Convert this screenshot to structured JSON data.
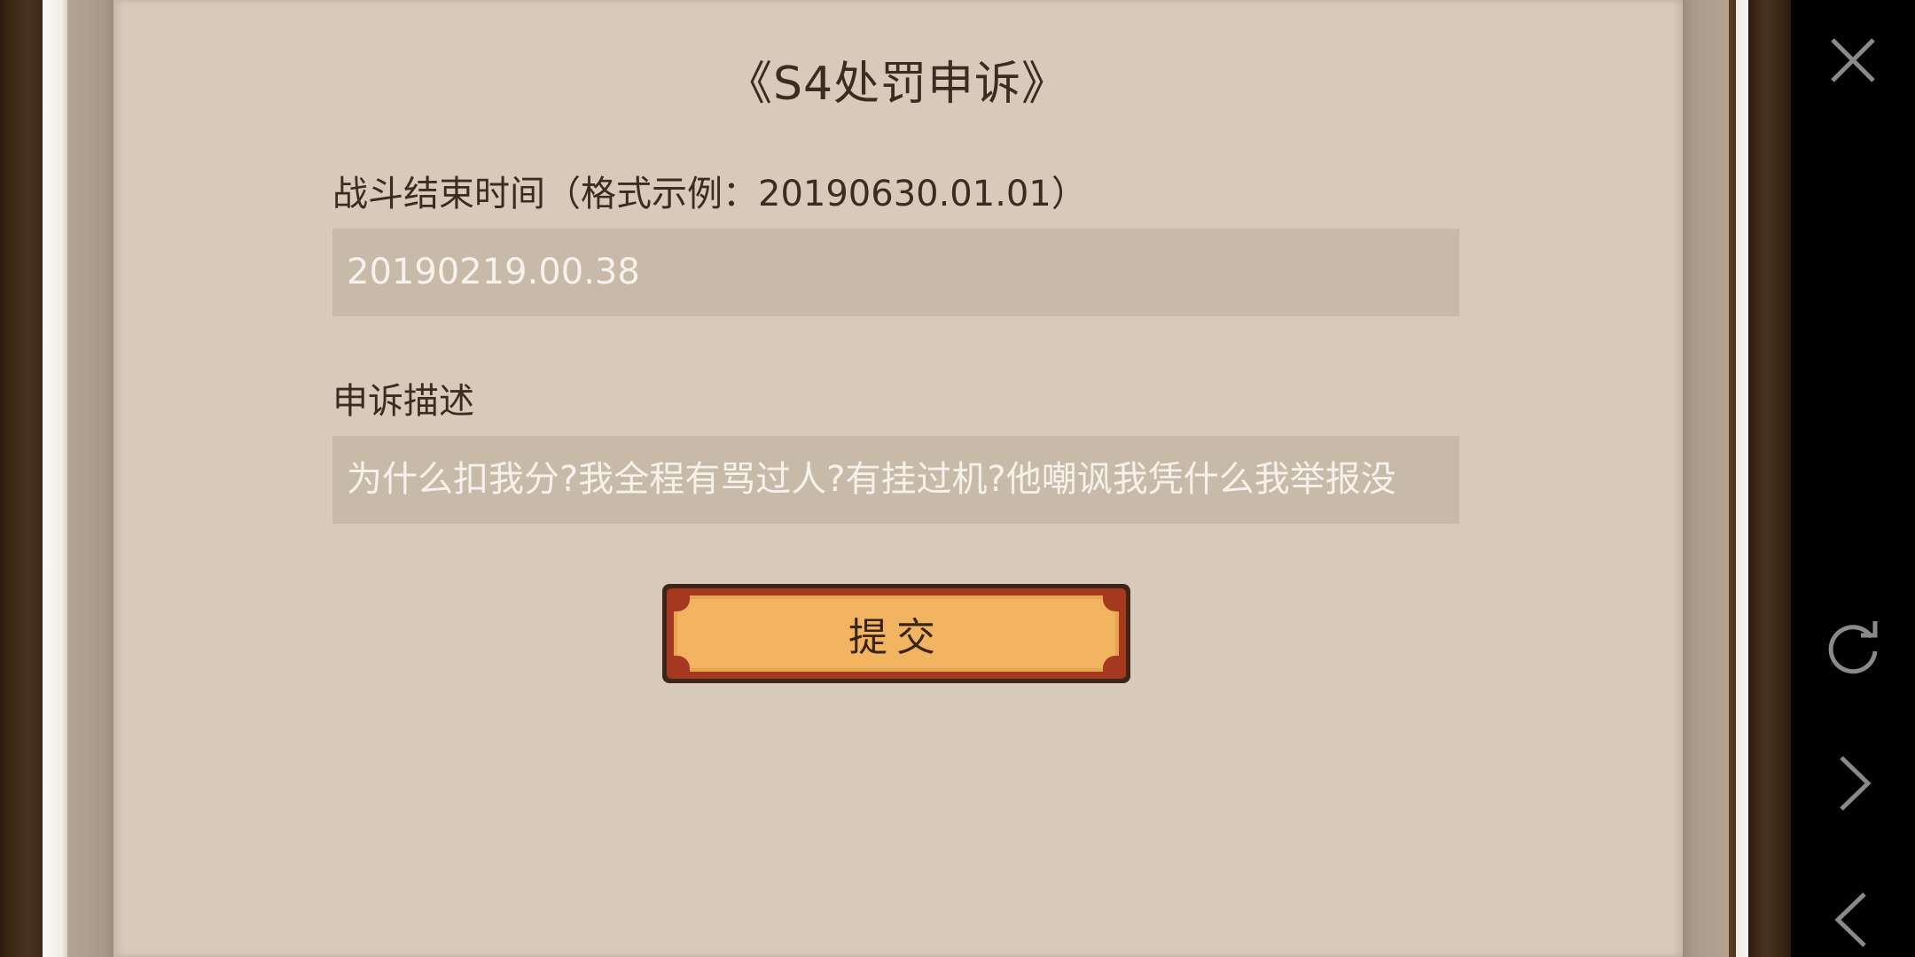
{
  "dialog": {
    "title": "《S4处罚申诉》",
    "battle_end_time_label": "战斗结束时间（格式示例：20190630.01.01）",
    "battle_end_time_value": "20190219.00.38",
    "description_label": "申诉描述",
    "description_value": "为什么扣我分?我全程有骂过人?有挂过机?他嘲讽我凭什么我举报没",
    "submit_label": "提交"
  },
  "navbar": {
    "icons": [
      "close-icon",
      "refresh-icon",
      "chevron-right-icon",
      "chevron-left-icon"
    ]
  },
  "colors": {
    "panel": "#d8cabb",
    "field": "#c8baa9",
    "button_face": "#f3b462",
    "button_ring": "#a5391f",
    "text": "#3a2c22"
  }
}
